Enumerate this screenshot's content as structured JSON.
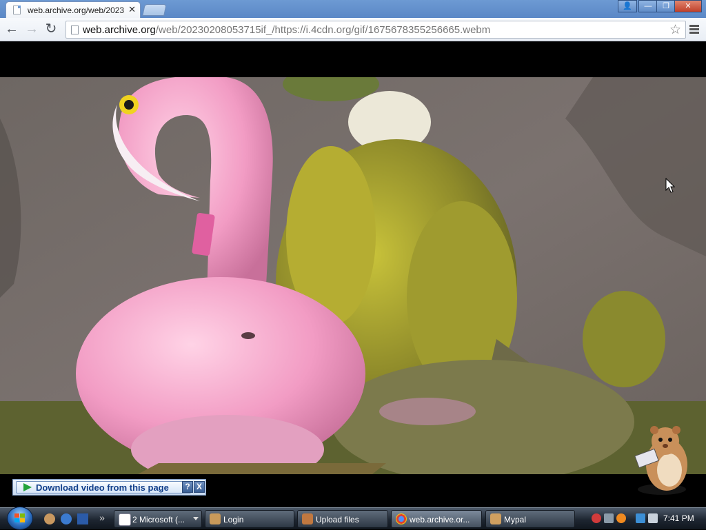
{
  "browser": {
    "tab_title": "web.archive.org/web/2023",
    "tab_close": "✕",
    "url_host": "web.archive.org",
    "url_rest": "/web/20230208053715if_/https://i.4cdn.org/gif/1675678355256665.webm",
    "nav": {
      "back": "←",
      "forward": "→",
      "reload": "↻"
    },
    "star": "☆",
    "window_buttons": {
      "user": "👤",
      "minimize": "—",
      "maximize": "❐",
      "close": "✕"
    }
  },
  "overlay": {
    "download_label": "Download video from this page",
    "help": "?",
    "close": "X"
  },
  "taskbar": {
    "quicklaunch_more": "»",
    "buttons": [
      {
        "label": "2 Microsoft (...",
        "color": "#ffffff",
        "icon": "window-icon",
        "active": false
      },
      {
        "label": "Login",
        "color": "#c99a5a",
        "icon": "hamster-icon",
        "active": false
      },
      {
        "label": "Upload files",
        "color": "#c07840",
        "icon": "hamster-icon",
        "active": false
      },
      {
        "label": "web.archive.or...",
        "color": "#4d90fe",
        "icon": "chrome-icon",
        "active": true
      },
      {
        "label": "Mypal",
        "color": "#d0a060",
        "icon": "hamster-icon",
        "active": false
      }
    ],
    "clock": "7:41 PM"
  }
}
